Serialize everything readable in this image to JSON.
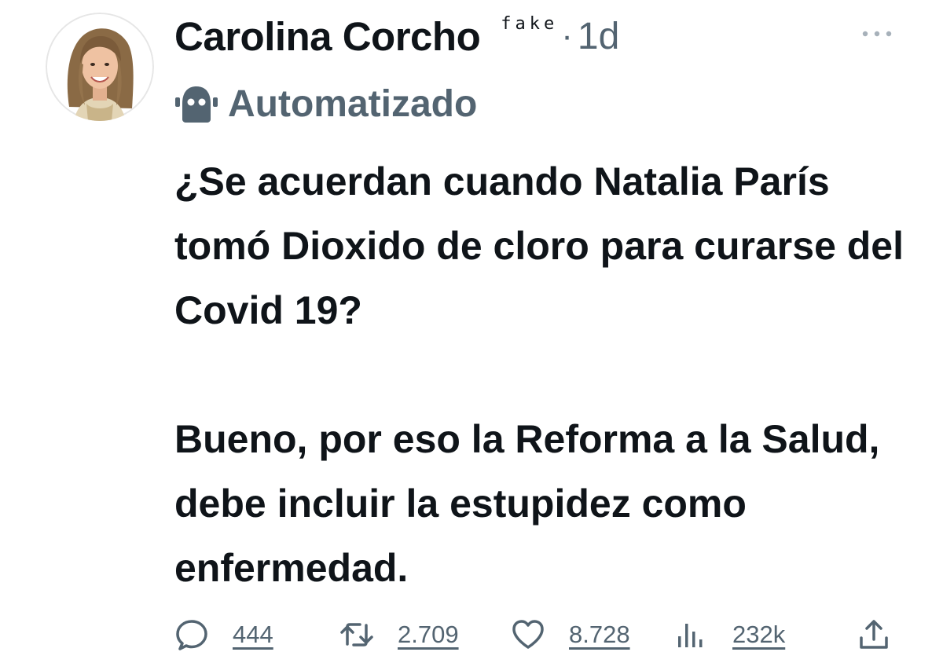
{
  "author": {
    "name": "Carolina Corcho",
    "badge": "fake",
    "separator": "·",
    "time": "1d",
    "label": "Automatizado"
  },
  "tweet": {
    "paragraphs": [
      "¿Se acuerdan cuando Natalia París tomó Dioxido de cloro para curarse del Covid 19?",
      "Bueno, por eso la Reforma a la Salud, debe incluir la estupidez como enfermedad."
    ]
  },
  "stats": {
    "replies": "444",
    "retweets": "2.709",
    "likes": "8.728",
    "views": "232k"
  },
  "icons": {
    "more": "more-horizontal-icon",
    "automated": "bot-icon",
    "reply": "reply-icon",
    "retweet": "retweet-icon",
    "like": "heart-icon",
    "views": "views-icon",
    "share": "share-icon"
  },
  "colors": {
    "text": "#0f1419",
    "secondary": "#536471"
  }
}
